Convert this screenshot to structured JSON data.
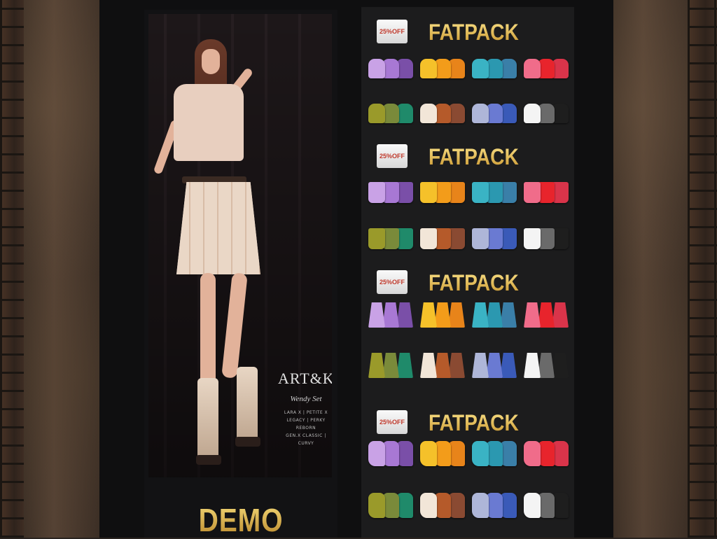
{
  "poster": {
    "demo_label": "DEMO",
    "brand_logo": "ART&KO",
    "set_name": "Wendy Set",
    "body_lines": [
      "LARA X | PETITE X",
      "LEGACY | PERKY",
      "REBORN",
      "GEN.X CLASSIC | CURVY"
    ]
  },
  "panel": {
    "sections": [
      {
        "badge": "25%OFF",
        "title": "FATPACK",
        "type": "top",
        "rows": [
          [
            [
              "#c9a2e6",
              "#a878d4",
              "#7a4fa8"
            ],
            [
              "#f5c12a",
              "#f39c1a",
              "#e8841a"
            ],
            [
              "#3ab3c4",
              "#2b98b0",
              "#3a7fa8"
            ],
            [
              "#f06c8a",
              "#e8242c",
              "#d9344a"
            ]
          ],
          [
            [
              "#9a9a2a",
              "#7a8a3a",
              "#1f8a6a"
            ],
            [
              "#f2e6d8",
              "#b55a2a",
              "#8a4a32"
            ],
            [
              "#aeb6d8",
              "#6a7ad2",
              "#3a5ab8"
            ],
            [
              "#f4f4f4",
              "#6a6a6a",
              "#1e1e1e"
            ]
          ]
        ]
      },
      {
        "badge": "25%OFF",
        "title": "FATPACK",
        "type": "shorts",
        "rows": [
          [
            [
              "#c9a2e6",
              "#a878d4",
              "#7a4fa8"
            ],
            [
              "#f5c12a",
              "#f39c1a",
              "#e8841a"
            ],
            [
              "#3ab3c4",
              "#2b98b0",
              "#3a7fa8"
            ],
            [
              "#f06c8a",
              "#e8242c",
              "#d9344a"
            ]
          ],
          [
            [
              "#9a9a2a",
              "#7a8a3a",
              "#1f8a6a"
            ],
            [
              "#f2e6d8",
              "#b55a2a",
              "#8a4a32"
            ],
            [
              "#aeb6d8",
              "#6a7ad2",
              "#3a5ab8"
            ],
            [
              "#f4f4f4",
              "#6a6a6a",
              "#1e1e1e"
            ]
          ]
        ]
      },
      {
        "badge": "25%OFF",
        "title": "FATPACK",
        "type": "skirt",
        "rows": [
          [
            [
              "#c9a2e6",
              "#a878d4",
              "#7a4fa8"
            ],
            [
              "#f5c12a",
              "#f39c1a",
              "#e8841a"
            ],
            [
              "#3ab3c4",
              "#2b98b0",
              "#3a7fa8"
            ],
            [
              "#f06c8a",
              "#e8242c",
              "#d9344a"
            ]
          ],
          [
            [
              "#9a9a2a",
              "#7a8a3a",
              "#1f8a6a"
            ],
            [
              "#f2e6d8",
              "#b55a2a",
              "#8a4a32"
            ],
            [
              "#aeb6d8",
              "#6a7ad2",
              "#3a5ab8"
            ],
            [
              "#f4f4f4",
              "#6a6a6a",
              "#1e1e1e"
            ]
          ]
        ]
      },
      {
        "badge": "25%OFF",
        "title": "FATPACK",
        "type": "boot",
        "rows": [
          [
            [
              "#c9a2e6",
              "#a878d4",
              "#7a4fa8"
            ],
            [
              "#f5c12a",
              "#f39c1a",
              "#e8841a"
            ],
            [
              "#3ab3c4",
              "#2b98b0",
              "#3a7fa8"
            ],
            [
              "#f06c8a",
              "#e8242c",
              "#d9344a"
            ]
          ],
          [
            [
              "#9a9a2a",
              "#7a8a3a",
              "#1f8a6a"
            ],
            [
              "#f2e6d8",
              "#b55a2a",
              "#8a4a32"
            ],
            [
              "#aeb6d8",
              "#6a7ad2",
              "#3a5ab8"
            ],
            [
              "#f4f4f4",
              "#6a6a6a",
              "#1e1e1e"
            ]
          ]
        ]
      }
    ]
  }
}
